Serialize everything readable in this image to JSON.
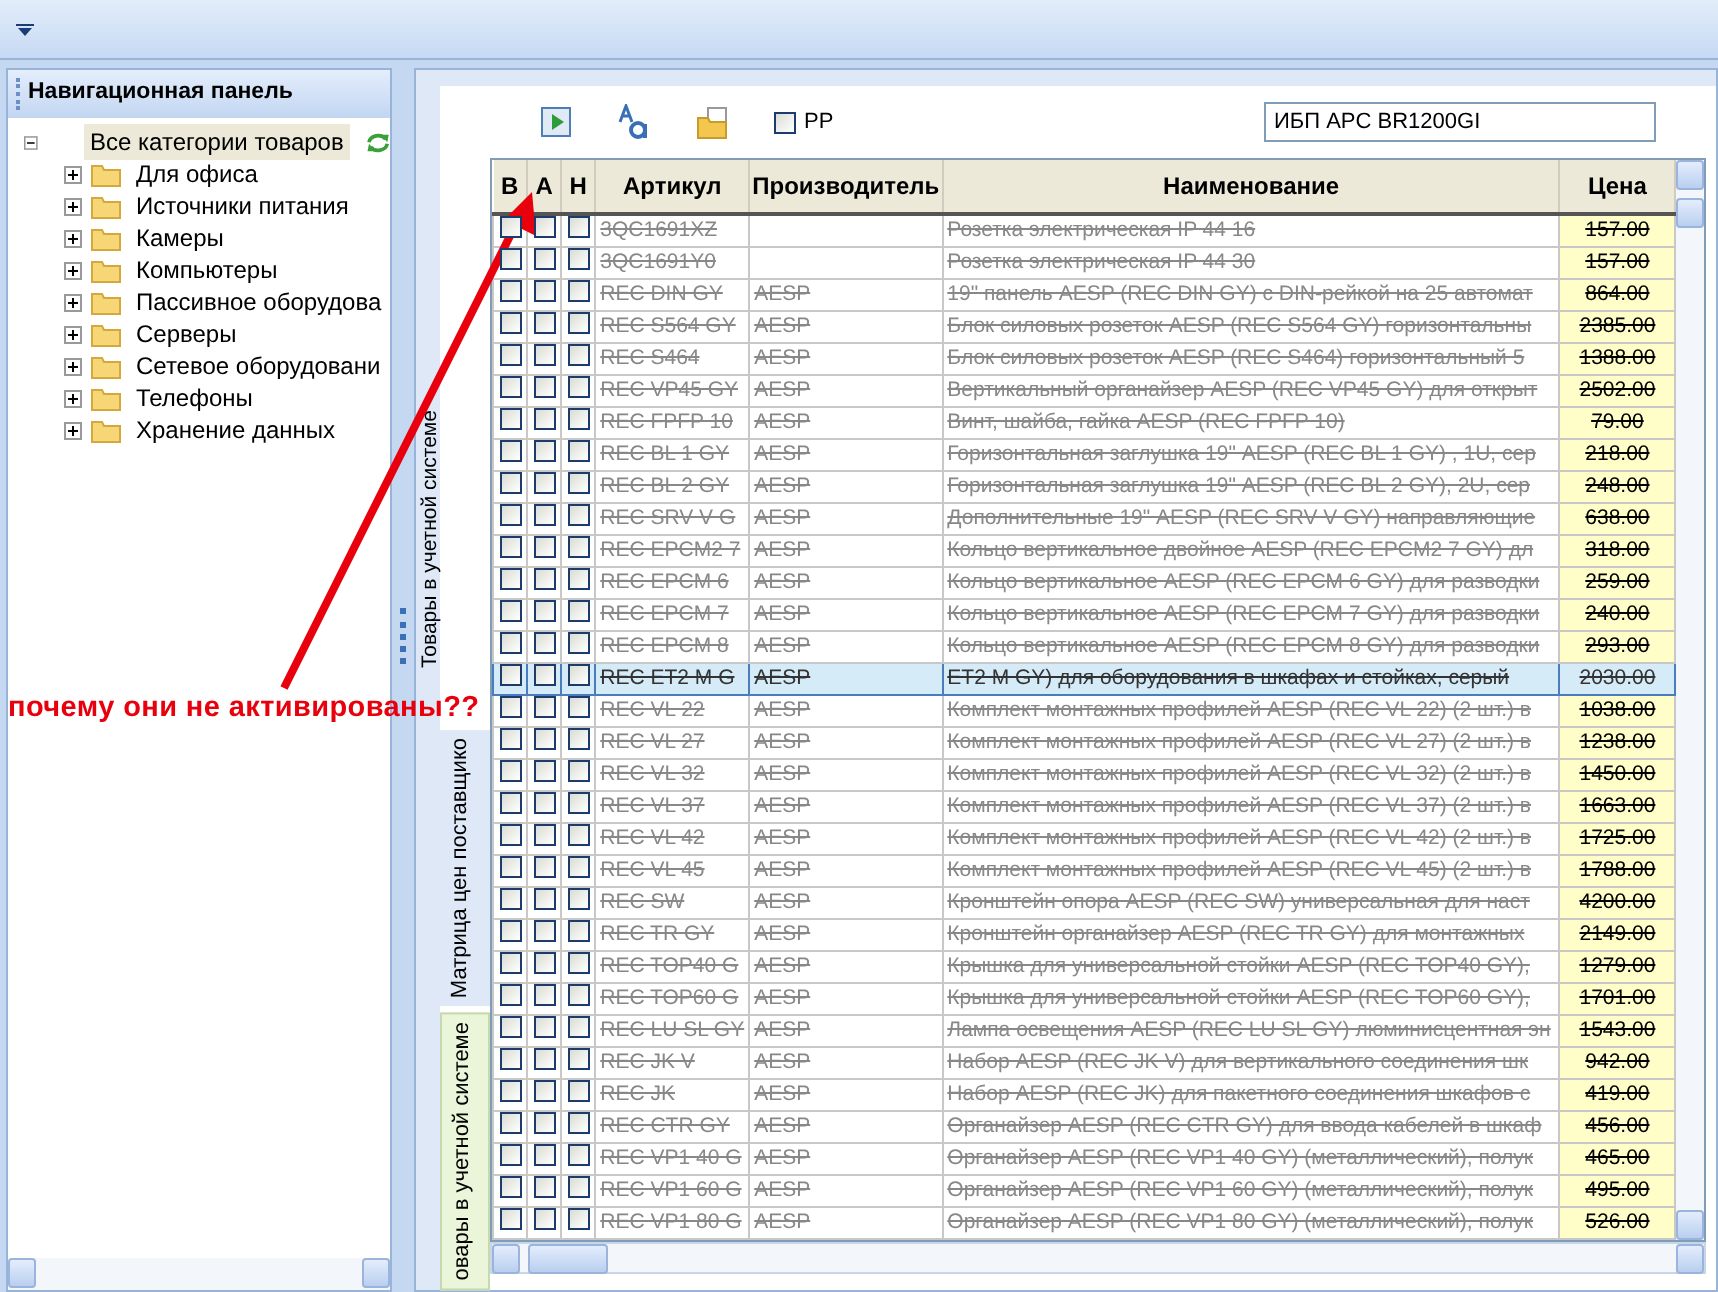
{
  "nav_panel": {
    "title": "Навигационная панель",
    "tree": [
      {
        "label": "Все категории товаров",
        "selected": true,
        "expanded": true,
        "children": [
          {
            "label": "Для офиса",
            "expanded": false
          },
          {
            "label": "Источники питания",
            "expanded": false
          },
          {
            "label": "Камеры",
            "expanded": false
          },
          {
            "label": "Компьютеры",
            "expanded": false
          },
          {
            "label": "Пассивное оборудова",
            "expanded": false
          },
          {
            "label": "Серверы",
            "expanded": false
          },
          {
            "label": "Сетевое оборудовани",
            "expanded": false
          },
          {
            "label": "Телефоны",
            "expanded": false
          },
          {
            "label": "Хранение данных",
            "expanded": false
          }
        ]
      }
    ]
  },
  "side_tabs": [
    {
      "label": "Товары в учетной системе",
      "selected": false
    },
    {
      "label": "Матрица цен поставщико",
      "selected": false
    },
    {
      "label": "овары в учетной системе",
      "selected": true
    }
  ],
  "toolbar": {
    "pp_checkbox": {
      "label": "PP",
      "checked": false
    },
    "search": {
      "value": "ИБП APC BR1200GI"
    }
  },
  "table": {
    "columns": [
      "В",
      "А",
      "Н",
      "Артикул",
      "Производитель",
      "Наименование",
      "Цена"
    ],
    "rows": [
      {
        "article": "3QC1691XZ",
        "name": "Розетка электрическая IP 44 16",
        "price": "157.00",
        "checks": [
          false,
          false,
          false
        ],
        "struck": true,
        "selected": false
      },
      {
        "article": "3QC1691Y0",
        "name": "Розетка электрическая IP 44 30",
        "price": "157.00",
        "checks": [
          false,
          false,
          false
        ],
        "struck": true,
        "selected": false
      },
      {
        "article": "REC DIN GY",
        "maker": "AESP",
        "name": "19\" панель AESP (REC DIN GY) с DIN-рейкой на 25 автомат",
        "price": "864.00",
        "checks": [
          false,
          false,
          false
        ],
        "struck": true,
        "selected": false
      },
      {
        "article": "REC S564 GY",
        "maker": "AESP",
        "name": "Блок силовых розеток AESP (REC S564 GY) горизонтальны",
        "price": "2385.00",
        "checks": [
          false,
          false,
          false
        ],
        "struck": true,
        "selected": false
      },
      {
        "article": "REC S464",
        "maker": "AESP",
        "name": "Блок силовых розеток AESP (REC S464) горизонтальный 5",
        "price": "1388.00",
        "checks": [
          false,
          false,
          false
        ],
        "struck": true,
        "selected": false
      },
      {
        "article": "REC VP45 GY",
        "maker": "AESP",
        "name": "Вертикальный органайзер AESP (REC VP45 GY) для открыт",
        "price": "2502.00",
        "checks": [
          false,
          false,
          false
        ],
        "struck": true,
        "selected": false
      },
      {
        "article": "REC FPFP 10",
        "maker": "AESP",
        "name": "Винт, шайба, гайка AESP (REC FPFP 10)",
        "price": "79.00",
        "checks": [
          false,
          false,
          false
        ],
        "struck": true,
        "selected": false
      },
      {
        "article": "REC BL 1 GY",
        "maker": "AESP",
        "name": "Горизонтальная заглушка 19\" AESP (REC BL 1 GY) , 1U, сер",
        "price": "218.00",
        "checks": [
          false,
          false,
          false
        ],
        "struck": true,
        "selected": false
      },
      {
        "article": "REC BL 2 GY",
        "maker": "AESP",
        "name": "Горизонтальная заглушка 19\" AESP (REC BL 2 GY), 2U, сер",
        "price": "248.00",
        "checks": [
          false,
          false,
          false
        ],
        "struck": true,
        "selected": false
      },
      {
        "article": "REC SRV V G",
        "maker": "AESP",
        "name": "Дополнительные 19\" AESP (REC SRV V GY) направляющие",
        "price": "638.00",
        "checks": [
          false,
          false,
          false
        ],
        "struck": true,
        "selected": false
      },
      {
        "article": "REC EPCM2 7",
        "maker": "AESP",
        "name": "Кольцо вертикальное двойное AESP (REC EPCM2 7 GY) дл",
        "price": "318.00",
        "checks": [
          false,
          false,
          false
        ],
        "struck": true,
        "selected": false
      },
      {
        "article": "REC EPCM 6",
        "maker": "AESP",
        "name": "Кольцо вертикальное AESP (REC EPCM 6 GY) для разводки",
        "price": "259.00",
        "checks": [
          false,
          false,
          false
        ],
        "struck": true,
        "selected": false
      },
      {
        "article": "REC EPCM 7",
        "maker": "AESP",
        "name": "Кольцо вертикальное AESP (REC EPCM 7 GY) для разводки",
        "price": "240.00",
        "checks": [
          false,
          false,
          false
        ],
        "struck": true,
        "selected": false
      },
      {
        "article": "REC EPCM 8",
        "maker": "AESP",
        "name": "Кольцо вертикальное AESP (REC EPCM 8 GY) для разводки",
        "price": "293.00",
        "checks": [
          false,
          false,
          false
        ],
        "struck": true,
        "selected": false
      },
      {
        "article": "REC ET2 M G",
        "maker": "AESP",
        "name": "ET2 M GY) для оборудования в шкафах и стойках, серый",
        "price": "2030.00",
        "checks": [
          false,
          false,
          false
        ],
        "struck": true,
        "selected": true
      },
      {
        "article": "REC VL 22",
        "maker": "AESP",
        "name": "Комплект монтажных профилей AESP (REC VL 22) (2 шт.) в",
        "price": "1038.00",
        "checks": [
          false,
          false,
          false
        ],
        "struck": true,
        "selected": false
      },
      {
        "article": "REC VL 27",
        "maker": "AESP",
        "name": "Комплект монтажных профилей AESP (REC VL 27) (2 шт.) в",
        "price": "1238.00",
        "checks": [
          false,
          false,
          false
        ],
        "struck": true,
        "selected": false
      },
      {
        "article": "REC VL 32",
        "maker": "AESP",
        "name": "Комплект монтажных профилей AESP (REC VL 32) (2 шт.) в",
        "price": "1450.00",
        "checks": [
          false,
          false,
          false
        ],
        "struck": true,
        "selected": false
      },
      {
        "article": "REC VL 37",
        "maker": "AESP",
        "name": "Комплект монтажных профилей AESP (REC VL 37) (2 шт.) в",
        "price": "1663.00",
        "checks": [
          false,
          false,
          false
        ],
        "struck": true,
        "selected": false
      },
      {
        "article": "REC VL 42",
        "maker": "AESP",
        "name": "Комплект монтажных профилей AESP (REC VL 42) (2 шт.) в",
        "price": "1725.00",
        "checks": [
          false,
          false,
          false
        ],
        "struck": true,
        "selected": false
      },
      {
        "article": "REC VL 45",
        "maker": "AESP",
        "name": "Комплект монтажных профилей AESP (REC VL 45) (2 шт.) в",
        "price": "1788.00",
        "checks": [
          false,
          false,
          false
        ],
        "struck": true,
        "selected": false
      },
      {
        "article": "REC SW",
        "maker": "AESP",
        "name": "Кронштейн опора AESP (REC SW) универсальная для наст",
        "price": "4200.00",
        "checks": [
          false,
          false,
          false
        ],
        "struck": true,
        "selected": false
      },
      {
        "article": "REC TR GY",
        "maker": "AESP",
        "name": "Кронштейн органайзер AESP (REC TR GY) для монтажных",
        "price": "2149.00",
        "checks": [
          false,
          false,
          false
        ],
        "struck": true,
        "selected": false
      },
      {
        "article": "REC TOP40 G",
        "maker": "AESP",
        "name": "Крышка для универсальной стойки AESP (REC TOP40 GY),",
        "price": "1279.00",
        "checks": [
          false,
          false,
          false
        ],
        "struck": true,
        "selected": false
      },
      {
        "article": "REC TOP60 G",
        "maker": "AESP",
        "name": "Крышка для универсальной стойки AESP (REC TOP60 GY),",
        "price": "1701.00",
        "checks": [
          false,
          false,
          false
        ],
        "struck": true,
        "selected": false
      },
      {
        "article": "REC LU SL GY",
        "maker": "AESP",
        "name": "Лампа освещения AESP (REC LU SL GY) люминисцентная эн",
        "price": "1543.00",
        "checks": [
          false,
          false,
          false
        ],
        "struck": true,
        "selected": false
      },
      {
        "article": "REC JK V",
        "maker": "AESP",
        "name": "Набор AESP (REC JK V) для вертикального соединения шк",
        "price": "942.00",
        "checks": [
          false,
          false,
          false
        ],
        "struck": true,
        "selected": false
      },
      {
        "article": "REC JK",
        "maker": "AESP",
        "name": "Набор AESP (REC JK) для пакетного соединения шкафов с",
        "price": "419.00",
        "checks": [
          false,
          false,
          false
        ],
        "struck": true,
        "selected": false
      },
      {
        "article": "REC CTR GY",
        "maker": "AESP",
        "name": "Органайзер AESP (REC CTR GY) для ввода кабелей в шкаф",
        "price": "456.00",
        "checks": [
          false,
          false,
          false
        ],
        "struck": true,
        "selected": false
      },
      {
        "article": "REC VP1 40 G",
        "maker": "AESP",
        "name": "Органайзер AESP (REC VP1 40 GY) (металлический), полук",
        "price": "465.00",
        "checks": [
          false,
          false,
          false
        ],
        "struck": true,
        "selected": false
      },
      {
        "article": "REC VP1 60 G",
        "maker": "AESP",
        "name": "Органайзер AESP (REC VP1 60 GY) (металлический), полук",
        "price": "495.00",
        "checks": [
          false,
          false,
          false
        ],
        "struck": true,
        "selected": false
      },
      {
        "article": "REC VP1 80 G",
        "maker": "AESP",
        "name": "Органайзер AESP (REC VP1 80 GY) (металлический), полук",
        "price": "526.00",
        "checks": [
          false,
          false,
          false
        ],
        "struck": true,
        "selected": false
      }
    ]
  },
  "annotation": {
    "text": "почему они не активированы??"
  }
}
